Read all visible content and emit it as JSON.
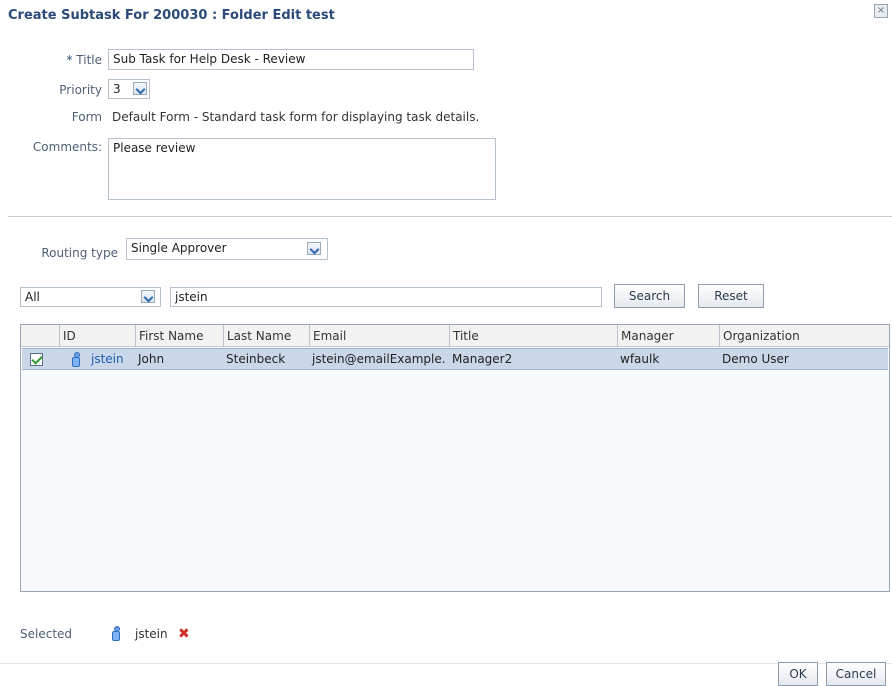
{
  "dialog": {
    "title": "Create Subtask For 200030 : Folder Edit test",
    "close_glyph": "×"
  },
  "form": {
    "required_marker": "*",
    "title_label": "Title",
    "title_value": "Sub Task for Help Desk - Review",
    "priority_label": "Priority",
    "priority_value": "3",
    "form_label": "Form",
    "form_value": "Default Form - Standard task form for displaying task details.",
    "comments_label": "Comments:",
    "comments_value": "Please review"
  },
  "routing": {
    "label": "Routing type",
    "value": "Single Approver"
  },
  "search": {
    "scope_value": "All",
    "query_value": "jstein",
    "search_label": "Search",
    "reset_label": "Reset"
  },
  "table": {
    "columns": [
      "ID",
      "First Name",
      "Last Name",
      "Email",
      "Title",
      "Manager",
      "Organization"
    ],
    "rows": [
      {
        "selected": true,
        "id": "jstein",
        "first_name": "John",
        "last_name": "Steinbeck",
        "email": "jstein@emailExample.",
        "title": "Manager2",
        "manager": "wfaulk",
        "organization": "Demo User"
      }
    ]
  },
  "selected": {
    "label": "Selected",
    "user": "jstein",
    "remove_glyph": "✖"
  },
  "footer": {
    "ok_label": "OK",
    "ok_mnemonic": "K",
    "cancel_label": "Cancel",
    "cancel_mnemonic": "C"
  },
  "colors": {
    "title": "#2b4a7a",
    "link": "#1c5eb3",
    "row_selected": "#c9d7e8",
    "remove": "#d0312d"
  },
  "icons": {
    "close": "close-icon",
    "dropdown": "chevron-down-icon",
    "checkbox": "checkbox-checked-icon",
    "user": "user-icon",
    "remove": "remove-icon"
  }
}
